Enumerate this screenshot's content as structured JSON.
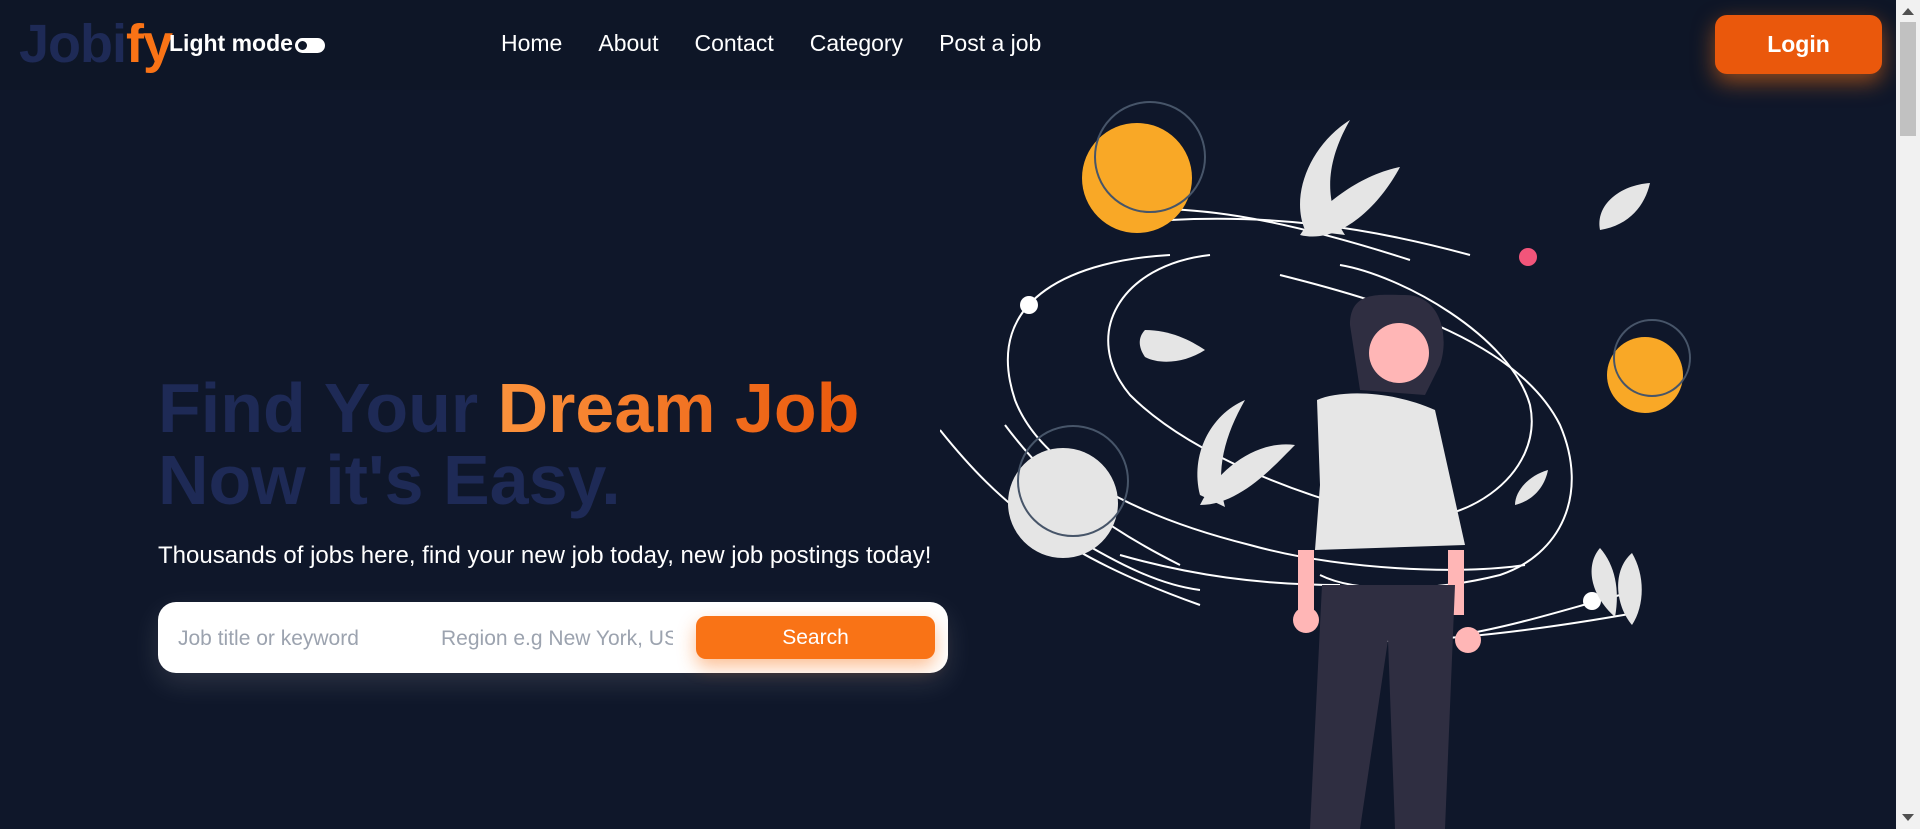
{
  "header": {
    "logo_part1": "Jobi",
    "logo_part2": "fy",
    "mode_label": "Light mode",
    "nav": [
      "Home",
      "About",
      "Contact",
      "Category",
      "Post a job"
    ],
    "login_label": "Login"
  },
  "hero": {
    "title_part1": "Find Your ",
    "title_highlight": "Dream Job",
    "title_line2": "Now it's Easy.",
    "subtitle": "Thousands of jobs here, find your new job today, new job postings today!",
    "search": {
      "job_placeholder": "Job title or keyword",
      "region_placeholder": "Region e.g New York, US",
      "button_label": "Search"
    }
  },
  "colors": {
    "background": "#0f172a",
    "accent": "#f97316",
    "accent_dark": "#ea580c",
    "logo_dim": "#1e2a56",
    "planet_yellow": "#f9a826"
  },
  "icons": [
    "toggle-switch-icon",
    "scroll-up-icon",
    "scroll-down-icon"
  ]
}
